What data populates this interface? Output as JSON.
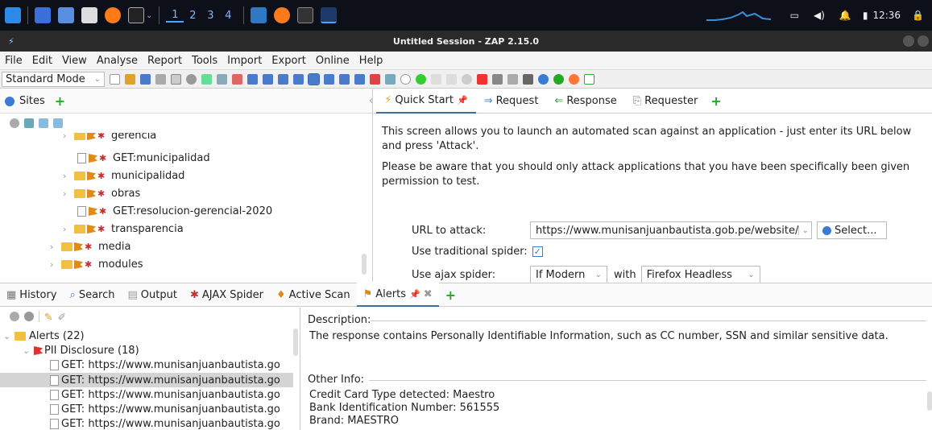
{
  "taskbar": {
    "workspaces": [
      "1",
      "2",
      "3",
      "4"
    ],
    "clock": "12:36"
  },
  "window": {
    "title": "Untitled Session - ZAP 2.15.0"
  },
  "menu": [
    "File",
    "Edit",
    "View",
    "Analyse",
    "Report",
    "Tools",
    "Import",
    "Export",
    "Online",
    "Help"
  ],
  "toolbar": {
    "mode": "Standard Mode"
  },
  "sites": {
    "tab_label": "Sites",
    "tree": [
      {
        "label": "gerencia",
        "type": "folder",
        "indent": 1
      },
      {
        "label": "GET:municipalidad",
        "type": "page",
        "indent": 1
      },
      {
        "label": "municipalidad",
        "type": "folder",
        "indent": 1
      },
      {
        "label": "obras",
        "type": "folder",
        "indent": 1
      },
      {
        "label": "GET:resolucion-gerencial-2020",
        "type": "page",
        "indent": 1
      },
      {
        "label": "transparencia",
        "type": "folder",
        "indent": 1
      },
      {
        "label": "media",
        "type": "folder",
        "indent": 0
      },
      {
        "label": "modules",
        "type": "folder",
        "indent": 0
      }
    ]
  },
  "work_tabs": {
    "quick_start": "Quick Start",
    "request": "Request",
    "response": "Response",
    "requester": "Requester"
  },
  "quick_start": {
    "intro": "This screen allows you to launch an automated scan against  an application - just enter its URL below and press 'Attack'.",
    "warning": "Please be aware that you should only attack applications that you have been specifically been given permission to test.",
    "url_label": "URL to attack:",
    "url_value": "https://www.munisanjuanbautista.gob.pe/website/",
    "select_label": "Select...",
    "spider_label": "Use traditional spider:",
    "ajax_label": "Use ajax spider:",
    "ajax_mode": "If Modern",
    "with_label": "with",
    "browser": "Firefox Headless"
  },
  "bottom_tabs": {
    "history": "History",
    "search": "Search",
    "output": "Output",
    "ajax_spider": "AJAX Spider",
    "active_scan": "Active Scan",
    "alerts": "Alerts"
  },
  "alerts": {
    "root": "Alerts (22)",
    "group": "PII Disclosure (18)",
    "items": [
      "GET: https://www.munisanjuanbautista.go",
      "GET: https://www.munisanjuanbautista.go",
      "GET: https://www.munisanjuanbautista.go",
      "GET: https://www.munisanjuanbautista.go",
      "GET: https://www.munisanjuanbautista.go"
    ],
    "description_label": "Description:",
    "description": "The response contains Personally Identifiable Information, such as CC number, SSN and similar sensitive data.",
    "other_info_label": "Other Info:",
    "other_info": [
      "Credit Card Type detected: Maestro",
      "Bank Identification Number: 561555",
      "Brand: MAESTRO"
    ]
  }
}
